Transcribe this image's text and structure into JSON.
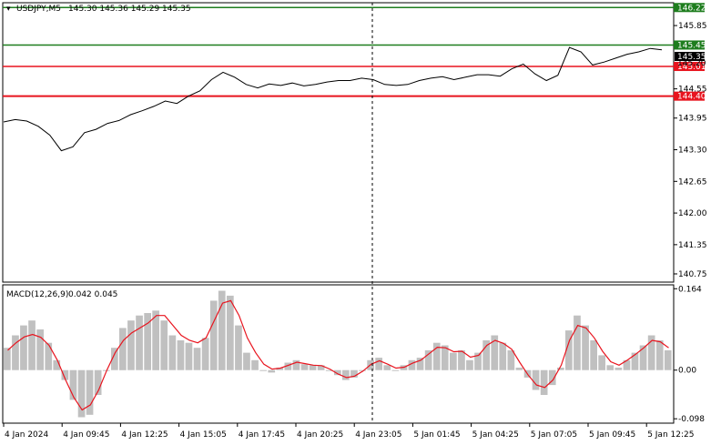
{
  "header": {
    "symbol_label": "USDJPY,M5",
    "ohlc_label": "145.30 145.36 145.29 145.35"
  },
  "indicator": {
    "name": "MACD(12,26,9)",
    "values": "0.042 0.045"
  },
  "price_axis": {
    "ticks": [
      {
        "v": 145.85,
        "t": "145.85"
      },
      {
        "v": 144.55,
        "t": "144.55"
      },
      {
        "v": 143.95,
        "t": "143.95"
      },
      {
        "v": 143.3,
        "t": "143.30"
      },
      {
        "v": 142.65,
        "t": "142.65"
      },
      {
        "v": 142.0,
        "t": "142.00"
      },
      {
        "v": 141.35,
        "t": "141.35"
      },
      {
        "v": 140.75,
        "t": "140.75"
      }
    ],
    "current_price": "145.35",
    "extra_label": "145.20"
  },
  "levels": [
    {
      "value": 146.22,
      "label": "146.22",
      "color": "#1e7d1e"
    },
    {
      "value": 145.45,
      "label": "145.45",
      "color": "#1e7d1e"
    },
    {
      "value": 145.01,
      "label": "145.01",
      "color": "#e8141e"
    },
    {
      "value": 144.4,
      "label": "144.40",
      "color": "#e8141e"
    }
  ],
  "macd_axis": {
    "ticks": [
      {
        "v": 0.164,
        "t": "0.164"
      },
      {
        "v": 0.0,
        "t": "0.00"
      },
      {
        "v": -0.098,
        "t": "-0.098"
      }
    ]
  },
  "time_axis": [
    "4 Jan 2024",
    "4 Jan 09:45",
    "4 Jan 12:25",
    "4 Jan 15:05",
    "4 Jan 17:45",
    "4 Jan 20:25",
    "4 Jan 23:05",
    "5 Jan 01:45",
    "5 Jan 04:25",
    "5 Jan 07:05",
    "5 Jan 09:45",
    "5 Jan 12:25"
  ],
  "chart_data": {
    "type": "line",
    "title": "USDJPY,M5",
    "price_series": [
      143.87,
      143.92,
      143.89,
      143.78,
      143.6,
      143.28,
      143.36,
      143.65,
      143.72,
      143.84,
      143.9,
      144.02,
      144.1,
      144.19,
      144.3,
      144.25,
      144.4,
      144.51,
      144.74,
      144.89,
      144.79,
      144.64,
      144.57,
      144.65,
      144.62,
      144.67,
      144.61,
      144.64,
      144.69,
      144.72,
      144.72,
      144.77,
      144.74,
      144.64,
      144.62,
      144.64,
      144.72,
      144.77,
      144.8,
      144.74,
      144.79,
      144.84,
      144.84,
      144.81,
      144.96,
      145.06,
      144.86,
      144.72,
      144.83,
      145.4,
      145.31,
      145.04,
      145.1,
      145.18,
      145.26,
      145.31,
      145.38,
      145.35
    ],
    "macd_histogram": [
      0.045,
      0.07,
      0.09,
      0.1,
      0.082,
      0.055,
      0.02,
      -0.02,
      -0.06,
      -0.095,
      -0.09,
      -0.05,
      0.0,
      0.045,
      0.085,
      0.1,
      0.11,
      0.115,
      0.12,
      0.1,
      0.07,
      0.06,
      0.055,
      0.045,
      0.065,
      0.14,
      0.16,
      0.15,
      0.09,
      0.035,
      0.02,
      0.0,
      -0.005,
      0.005,
      0.015,
      0.02,
      0.012,
      0.01,
      0.01,
      0.0,
      -0.01,
      -0.02,
      -0.015,
      0.0,
      0.02,
      0.025,
      0.01,
      0.0,
      0.01,
      0.02,
      0.025,
      0.04,
      0.055,
      0.05,
      0.035,
      0.04,
      0.02,
      0.035,
      0.06,
      0.07,
      0.055,
      0.04,
      0.005,
      -0.015,
      -0.04,
      -0.05,
      -0.03,
      0.005,
      0.08,
      0.11,
      0.09,
      0.06,
      0.03,
      0.01,
      0.005,
      0.02,
      0.035,
      0.05,
      0.07,
      0.06,
      0.04
    ],
    "macd_signal": [
      0.04,
      0.055,
      0.067,
      0.072,
      0.066,
      0.05,
      0.02,
      -0.02,
      -0.055,
      -0.08,
      -0.07,
      -0.04,
      0.0,
      0.035,
      0.06,
      0.075,
      0.085,
      0.095,
      0.11,
      0.11,
      0.09,
      0.07,
      0.06,
      0.055,
      0.065,
      0.1,
      0.135,
      0.14,
      0.11,
      0.065,
      0.035,
      0.012,
      0.002,
      0.004,
      0.01,
      0.016,
      0.013,
      0.01,
      0.009,
      0.002,
      -0.008,
      -0.015,
      -0.012,
      -0.002,
      0.012,
      0.019,
      0.012,
      0.004,
      0.006,
      0.014,
      0.02,
      0.033,
      0.046,
      0.045,
      0.037,
      0.038,
      0.026,
      0.03,
      0.05,
      0.06,
      0.054,
      0.042,
      0.015,
      -0.01,
      -0.03,
      -0.035,
      -0.02,
      0.01,
      0.06,
      0.09,
      0.085,
      0.065,
      0.038,
      0.017,
      0.01,
      0.02,
      0.032,
      0.045,
      0.06,
      0.057,
      0.045
    ],
    "price_ylim": [
      140.6,
      146.3
    ],
    "macd_ylim": [
      -0.105,
      0.17
    ],
    "grid": false
  }
}
